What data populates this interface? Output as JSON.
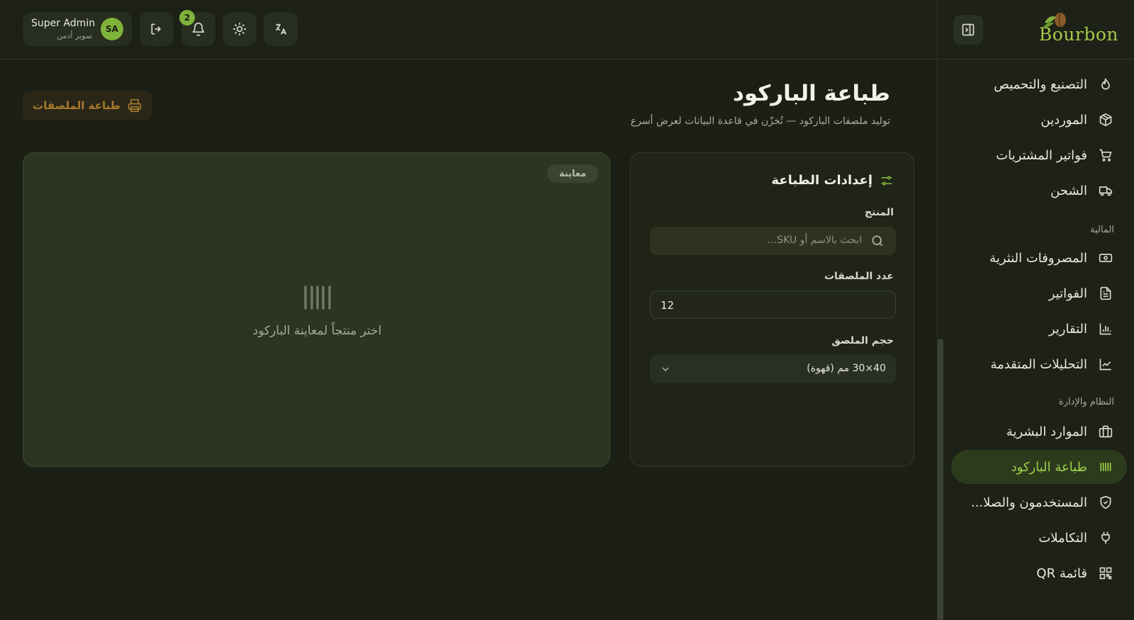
{
  "brand": {
    "logo_text": "Bourbon"
  },
  "topbar": {
    "user_name": "Super Admin",
    "user_role": "سوبر أدمن",
    "avatar_initials": "SA",
    "notifications_count": "2"
  },
  "sidebar": {
    "items": [
      {
        "label": "التصنيع والتحميص",
        "icon": "flame-icon"
      },
      {
        "label": "الموردين",
        "icon": "package-icon"
      },
      {
        "label": "فواتير المشتريات",
        "icon": "cart-icon"
      },
      {
        "label": "الشحن",
        "icon": "truck-icon"
      },
      {
        "label": "المصروفات النثرية",
        "icon": "banknote-icon"
      },
      {
        "label": "الفواتير",
        "icon": "document-icon"
      },
      {
        "label": "التقارير",
        "icon": "bar-chart-icon"
      },
      {
        "label": "التحليلات المتقدمة",
        "icon": "line-chart-icon"
      },
      {
        "label": "الموارد البشرية",
        "icon": "briefcase-icon"
      },
      {
        "label": "طباعة الباركود",
        "icon": "barcode-icon",
        "active": true
      },
      {
        "label": "المستخدمون والصلا...",
        "icon": "shield-icon"
      },
      {
        "label": "التكاملات",
        "icon": "plug-icon"
      },
      {
        "label": "قائمة QR",
        "icon": "qr-code-icon"
      }
    ],
    "sections": {
      "finance": "المالية",
      "system": "النظام والإدارة"
    }
  },
  "page": {
    "title": "طباعة الباركود",
    "subtitle": "توليد ملصقات الباركود — تُخزّن في قاعدة البيانات لعرض أسرع",
    "print_button": "طباعة الملصقات"
  },
  "settings": {
    "title": "إعدادات الطباعة",
    "product_label": "المنتج",
    "product_placeholder": "ابحث بالاسم أو SKU...",
    "count_label": "عدد الملصقات",
    "count_value": "12",
    "size_label": "حجم الملصق",
    "size_value": "40×30 مم (قهوة)"
  },
  "preview": {
    "badge": "معاينة",
    "empty_text": "اختر منتجاً لمعاينة الباركود"
  },
  "colors": {
    "accent": "#7fb23a",
    "active_text": "#9fd14a",
    "print_button_text": "#a67b2c",
    "background": "#1b1f15"
  }
}
